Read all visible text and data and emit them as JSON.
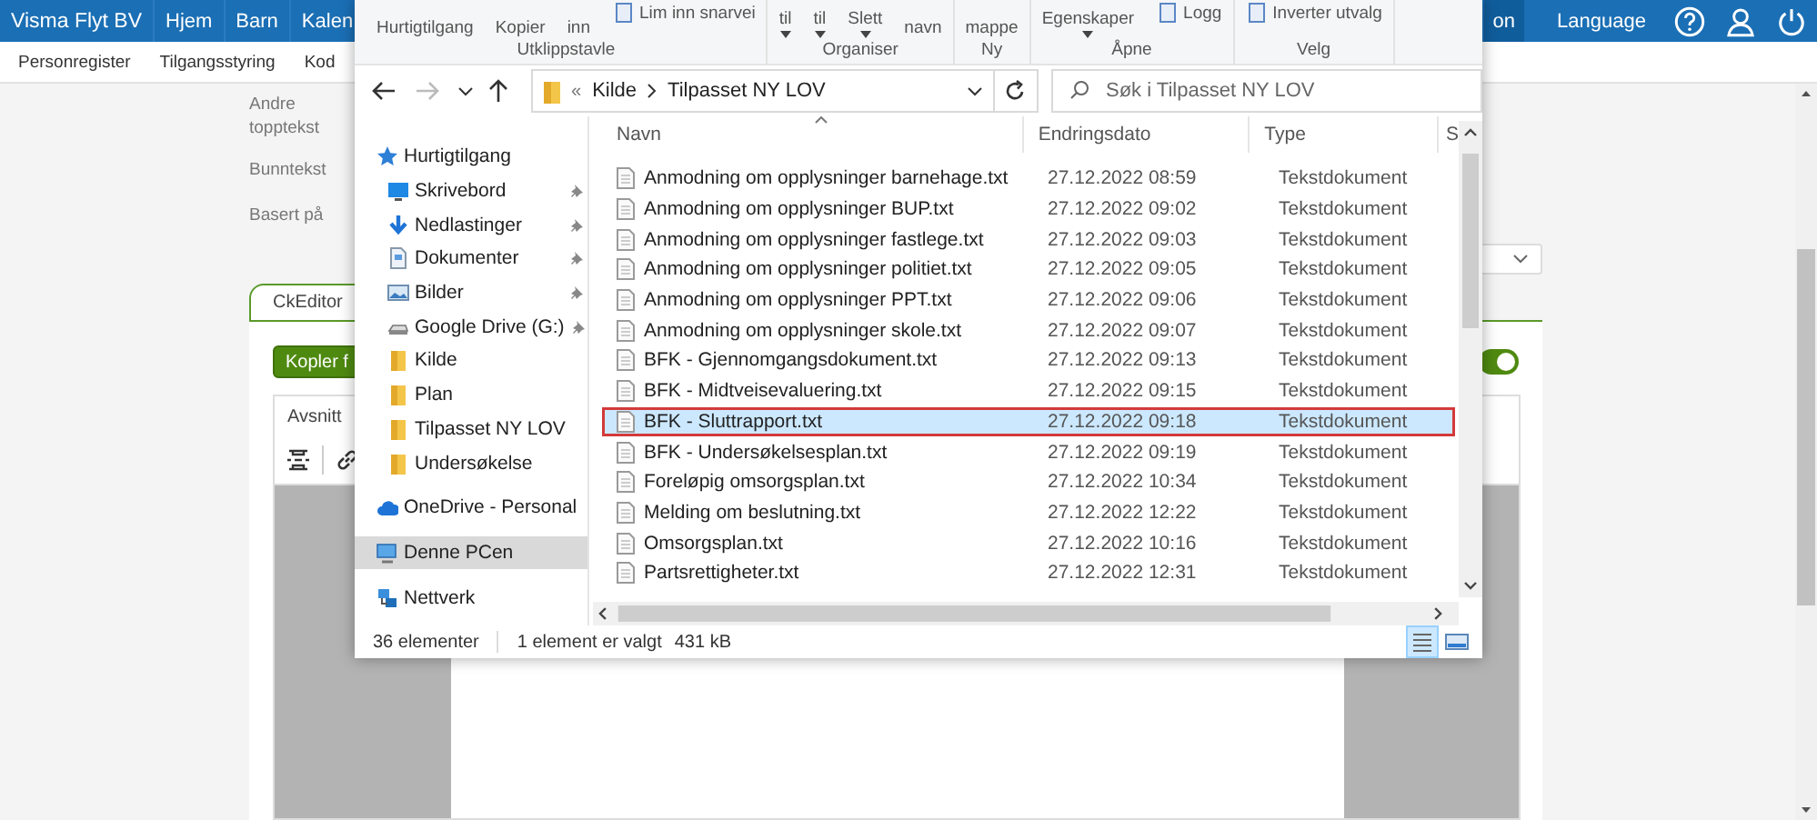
{
  "app": {
    "nav": [
      {
        "label": "Visma Flyt BV",
        "kind": "brand"
      },
      {
        "label": "Hjem",
        "kind": "link"
      },
      {
        "label": "Barn",
        "kind": "link"
      },
      {
        "label": "Kalen",
        "kind": "link"
      }
    ],
    "nav_right": [
      {
        "label": "on",
        "selected": true
      },
      {
        "label": "Language",
        "selected": false
      }
    ],
    "subnav": [
      "Personregister",
      "Tilgangsstyring",
      "Kod"
    ],
    "form_labels": [
      "Andre topptekst",
      "Bunntekst",
      "Basert på"
    ],
    "tabs": [
      {
        "label": "CkEditor",
        "selected": true
      }
    ],
    "copy_button": "Kopler f",
    "toggle": {
      "on": true
    },
    "editor": {
      "format": "Avsnitt"
    }
  },
  "dialog": {
    "ribbon": [
      {
        "label": "Utklippstavle",
        "items": [
          {
            "lines": [
              "Hurtigtilgang"
            ],
            "kind": "large",
            "caret": false
          },
          {
            "lines": [
              "Kopier"
            ],
            "kind": "large",
            "caret": false
          },
          {
            "lines": [
              "inn"
            ],
            "kind": "large",
            "caret": false
          },
          {
            "lines": [
              "Lim inn snarvei"
            ],
            "kind": "small",
            "caret": false
          }
        ]
      },
      {
        "label": "Organiser",
        "items": [
          {
            "lines": [
              "til"
            ],
            "kind": "large",
            "caret": true
          },
          {
            "lines": [
              "til"
            ],
            "kind": "large",
            "caret": true
          },
          {
            "lines": [
              "Slett"
            ],
            "kind": "large",
            "caret": true
          },
          {
            "lines": [
              "navn"
            ],
            "kind": "large",
            "caret": false
          }
        ]
      },
      {
        "label": "Ny",
        "items": [
          {
            "lines": [
              "mappe"
            ],
            "kind": "large",
            "caret": false
          }
        ]
      },
      {
        "label": "Åpne",
        "items": [
          {
            "lines": [
              "Egenskaper"
            ],
            "kind": "large",
            "caret": true
          },
          {
            "lines": [
              "Logg"
            ],
            "kind": "small",
            "caret": false
          }
        ]
      },
      {
        "label": "Velg",
        "items": [
          {
            "lines": [
              "Inverter utvalg"
            ],
            "kind": "small",
            "caret": false
          }
        ]
      }
    ],
    "address": {
      "overflow": "«",
      "path": [
        "Kilde",
        "Tilpasset NY LOV"
      ]
    },
    "search": {
      "placeholder": "Søk i Tilpasset NY LOV"
    },
    "nav_pane": [
      {
        "label": "Hurtigtilgang",
        "kind": "star",
        "selected": false,
        "children": [
          {
            "label": "Skrivebord",
            "kind": "desktop",
            "pinned": true,
            "selected": false
          },
          {
            "label": "Nedlastinger",
            "kind": "download",
            "pinned": true,
            "selected": false
          },
          {
            "label": "Dokumenter",
            "kind": "document",
            "pinned": true,
            "selected": false
          },
          {
            "label": "Bilder",
            "kind": "pictures",
            "pinned": true,
            "selected": false
          },
          {
            "label": "Google Drive (G:)",
            "kind": "drive",
            "pinned": true,
            "selected": false
          },
          {
            "label": "Kilde",
            "kind": "folder",
            "pinned": false,
            "selected": false
          },
          {
            "label": "Plan",
            "kind": "folder",
            "pinned": false,
            "selected": false
          },
          {
            "label": "Tilpasset NY LOV",
            "kind": "folder",
            "pinned": false,
            "selected": false
          },
          {
            "label": "Undersøkelse",
            "kind": "folder",
            "pinned": false,
            "selected": false
          }
        ]
      },
      {
        "label": "OneDrive - Personal",
        "kind": "cloud",
        "selected": false
      },
      {
        "label": "Denne PCen",
        "kind": "computer",
        "selected": true
      },
      {
        "label": "Nettverk",
        "kind": "network",
        "selected": false
      }
    ],
    "columns": [
      "Navn",
      "Endringsdato",
      "Type",
      "S"
    ],
    "files": [
      {
        "name": "Anmodning om opplysninger barnehage.txt",
        "modified": "27.12.2022 08:59",
        "type": "Tekstdokument",
        "selected": false,
        "outlined": false
      },
      {
        "name": "Anmodning om opplysninger BUP.txt",
        "modified": "27.12.2022 09:02",
        "type": "Tekstdokument",
        "selected": false,
        "outlined": false
      },
      {
        "name": "Anmodning om opplysninger fastlege.txt",
        "modified": "27.12.2022 09:03",
        "type": "Tekstdokument",
        "selected": false,
        "outlined": false
      },
      {
        "name": "Anmodning om opplysninger politiet.txt",
        "modified": "27.12.2022 09:05",
        "type": "Tekstdokument",
        "selected": false,
        "outlined": false
      },
      {
        "name": "Anmodning om opplysninger PPT.txt",
        "modified": "27.12.2022 09:06",
        "type": "Tekstdokument",
        "selected": false,
        "outlined": false
      },
      {
        "name": "Anmodning om opplysninger skole.txt",
        "modified": "27.12.2022 09:07",
        "type": "Tekstdokument",
        "selected": false,
        "outlined": false
      },
      {
        "name": "BFK - Gjennomgangsdokument.txt",
        "modified": "27.12.2022 09:13",
        "type": "Tekstdokument",
        "selected": false,
        "outlined": false
      },
      {
        "name": "BFK - Midtveisevaluering.txt",
        "modified": "27.12.2022 09:15",
        "type": "Tekstdokument",
        "selected": false,
        "outlined": false
      },
      {
        "name": "BFK - Sluttrapport.txt",
        "modified": "27.12.2022 09:18",
        "type": "Tekstdokument",
        "selected": true,
        "outlined": true
      },
      {
        "name": "BFK - Undersøkelsesplan.txt",
        "modified": "27.12.2022 09:19",
        "type": "Tekstdokument",
        "selected": false,
        "outlined": false
      },
      {
        "name": "Foreløpig omsorgsplan.txt",
        "modified": "27.12.2022 10:34",
        "type": "Tekstdokument",
        "selected": false,
        "outlined": false
      },
      {
        "name": "Melding om beslutning.txt",
        "modified": "27.12.2022 12:22",
        "type": "Tekstdokument",
        "selected": false,
        "outlined": false
      },
      {
        "name": "Omsorgsplan.txt",
        "modified": "27.12.2022 10:16",
        "type": "Tekstdokument",
        "selected": false,
        "outlined": false
      },
      {
        "name": "Partsrettigheter.txt",
        "modified": "27.12.2022 12:31",
        "type": "Tekstdokument",
        "selected": false,
        "outlined": false
      }
    ],
    "status": {
      "count": "36 elementer",
      "selection": "1 element er valgt",
      "size": "431 kB"
    },
    "views": [
      {
        "kind": "details",
        "selected": true
      },
      {
        "kind": "tiles",
        "selected": false
      }
    ]
  }
}
